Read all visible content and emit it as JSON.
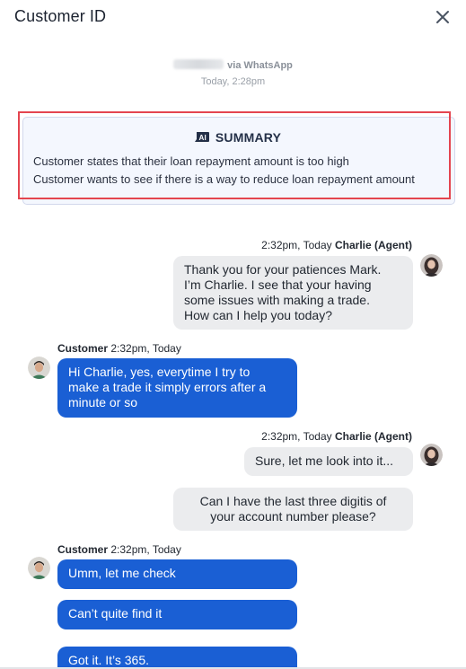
{
  "header": {
    "title": "Customer ID",
    "close_icon": "close-icon"
  },
  "conversation": {
    "source_suffix": "via WhatsApp",
    "source_name_blurred": true,
    "timestamp": "Today, 2:28pm"
  },
  "summary": {
    "heading": "SUMMARY",
    "icon": "ai-badge-icon",
    "lines": [
      "Customer states that their loan repayment amount is  too high",
      "Customer wants to see if there is a way to reduce loan repayment amount"
    ],
    "highlight_color": "#e4454f"
  },
  "messages": [
    {
      "side": "agent",
      "meta_time": "2:32pm, Today",
      "meta_author": "Charlie (Agent)",
      "bubbles": [
        [
          "Thank you for your patiences Mark.",
          "I’m Charlie. I see that your having",
          "some issues with making a trade.",
          "How can I help you today?"
        ]
      ]
    },
    {
      "side": "customer",
      "meta_author": "Customer",
      "meta_time": "2:32pm, Today",
      "bubbles": [
        [
          "Hi Charlie, yes, everytime I try to",
          "make a trade it simply errors after a",
          "minute or so"
        ]
      ]
    },
    {
      "side": "agent",
      "meta_time": "2:32pm, Today",
      "meta_author": "Charlie (Agent)",
      "bubbles": [
        [
          "Sure, let me look into it..."
        ],
        [
          "Can I have the last three digitis of",
          "your account number please?"
        ]
      ]
    },
    {
      "side": "customer",
      "meta_author": "Customer",
      "meta_time": "2:32pm, Today",
      "bubbles": [
        [
          "Umm, let me check"
        ],
        [
          "Can’t quite find it"
        ],
        [
          "Got it. It’s 365."
        ]
      ]
    }
  ],
  "colors": {
    "agent_bubble": "#ebecee",
    "customer_bubble": "#1a5fd4",
    "summary_bg": "#f4f7fe"
  }
}
